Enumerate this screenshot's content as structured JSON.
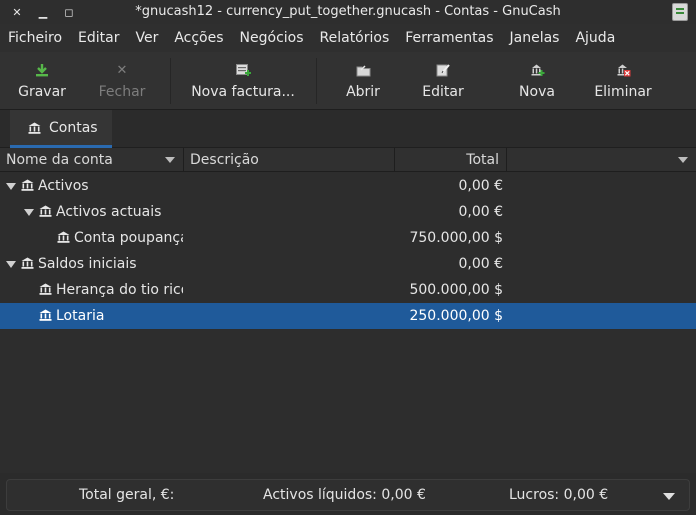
{
  "window": {
    "title": "*gnucash12 - currency_put_together.gnucash - Contas - GnuCash"
  },
  "menu": [
    "Ficheiro",
    "Editar",
    "Ver",
    "Acções",
    "Negócios",
    "Relatórios",
    "Ferramentas",
    "Janelas",
    "Ajuda"
  ],
  "toolbar": {
    "save": "Gravar",
    "close": "Fechar",
    "new_invoice": "Nova factura...",
    "open": "Abrir",
    "edit": "Editar",
    "new": "Nova",
    "delete": "Eliminar"
  },
  "tabs": [
    {
      "label": "Contas"
    }
  ],
  "columns": {
    "name": "Nome da conta",
    "description": "Descrição",
    "total": "Total"
  },
  "accounts": [
    {
      "name": "Activos",
      "total": "0,00 €",
      "level": 0,
      "expanded": true,
      "selected": false
    },
    {
      "name": "Activos actuais",
      "total": "0,00 €",
      "level": 1,
      "expanded": true,
      "selected": false
    },
    {
      "name": "Conta poupança",
      "total": "750.000,00 $",
      "level": 2,
      "expanded": false,
      "selected": false
    },
    {
      "name": "Saldos iniciais",
      "total": "0,00 €",
      "level": 0,
      "expanded": true,
      "selected": false
    },
    {
      "name": "Herança do tio rico",
      "total": "500.000,00 $",
      "level": 1,
      "expanded": false,
      "selected": false
    },
    {
      "name": "Lotaria",
      "total": "250.000,00 $",
      "level": 1,
      "expanded": false,
      "selected": true
    }
  ],
  "summary": {
    "grand_total": "Total geral, €:",
    "net_assets": "Activos líquidos: 0,00 €",
    "profits": "Lucros: 0,00 €"
  },
  "colors": {
    "accent": "#2a6ab0",
    "selection": "#1f5a9a"
  }
}
